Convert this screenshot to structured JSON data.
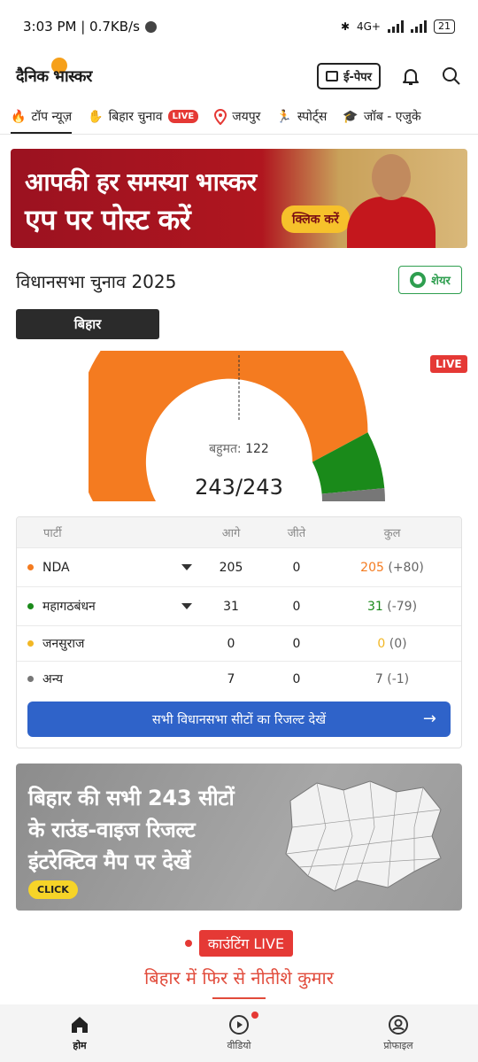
{
  "status_bar": {
    "time_speed": "3:03 PM | 0.7KB/s",
    "battery": "21",
    "network": "4G+"
  },
  "header": {
    "logo": "दैनिक भास्कर",
    "epaper_label": "ई-पेपर"
  },
  "tabs": [
    {
      "label": "टॉप न्यूज़",
      "icon": "flame-icon",
      "active": true
    },
    {
      "label": "बिहार चुनाव",
      "icon": "election-icon",
      "badge": "LIVE"
    },
    {
      "label": "जयपुर",
      "icon": "location-pin-icon"
    },
    {
      "label": "स्पोर्ट्स",
      "icon": "runner-icon"
    },
    {
      "label": "जॉब - एजुके",
      "icon": "graduation-cap-icon"
    }
  ],
  "banner": {
    "line1": "आपकी हर समस्या भास्कर",
    "line2": "एप पर पोस्ट करें",
    "cta": "क्लिक करें"
  },
  "election": {
    "title": "विधानसभा चुनाव 2025",
    "share_label": "शेयर",
    "state": "बिहार",
    "live": "LIVE",
    "majority_label": "बहुमत:",
    "majority_value": "122",
    "seats_total": "243/243",
    "columns": {
      "party": "पार्टी",
      "ahead": "आगे",
      "won": "जीते",
      "total": "कुल"
    },
    "rows": [
      {
        "party": "NDA",
        "color": "#f47b20",
        "ahead": "205",
        "won": "0",
        "total": "205",
        "change": "(+80)",
        "expandable": true
      },
      {
        "party": "महागठबंधन",
        "color": "#1a8a1a",
        "ahead": "31",
        "won": "0",
        "total": "31",
        "change": "(-79)",
        "expandable": true
      },
      {
        "party": "जनसुराज",
        "color": "#f2b724",
        "ahead": "0",
        "won": "0",
        "total": "0",
        "change": "(0)",
        "expandable": false
      },
      {
        "party": "अन्य",
        "color": "#777777",
        "ahead": "7",
        "won": "0",
        "total": "7",
        "change": "(-1)",
        "expandable": false
      }
    ],
    "all_results_label": "सभी विधानसभा सीटों का रिजल्ट देखें",
    "all_results_arrow": "→"
  },
  "map_promo": {
    "line1": "बिहार की सभी 243 सीटों",
    "line2": "के राउंड-वाइज रिजल्ट",
    "line3": "इंटरेक्टिव मैप पर देखें",
    "cta": "CLICK"
  },
  "counting": {
    "label": "काउंटिंग LIVE",
    "headline": "बिहार में फिर से नीतीशे कुमार"
  },
  "bottom_nav": [
    {
      "label": "होम",
      "icon": "home-icon",
      "active": true
    },
    {
      "label": "वीडियो",
      "icon": "play-icon",
      "notification": true
    },
    {
      "label": "प्रोफाइल",
      "icon": "profile-icon"
    }
  ],
  "chart_data": {
    "type": "pie",
    "title": "",
    "total_seats": 243,
    "majority": 122,
    "categories": [
      "NDA",
      "महागठबंधन",
      "जनसुराज",
      "अन्य"
    ],
    "values": [
      205,
      31,
      0,
      7
    ],
    "colors": [
      "#f47b20",
      "#1a8a1a",
      "#f2b724",
      "#777777"
    ]
  }
}
